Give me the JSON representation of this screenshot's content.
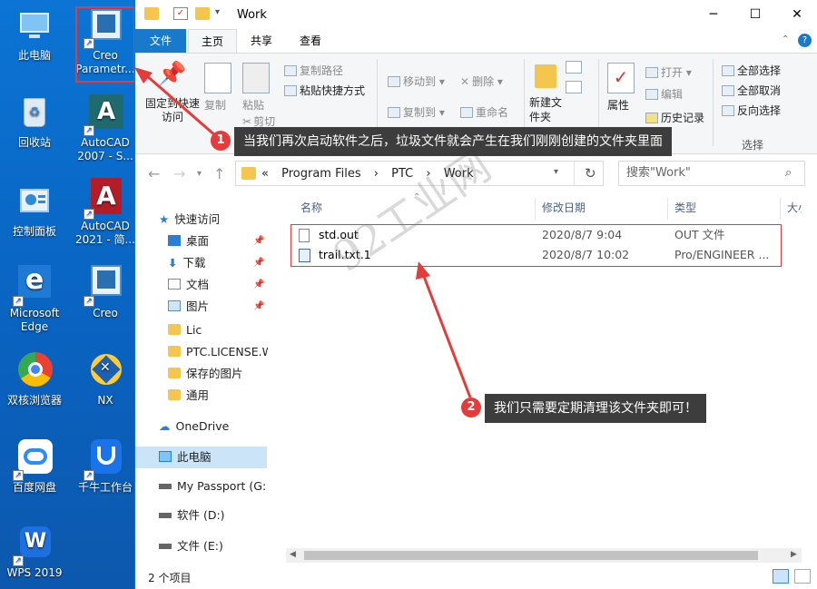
{
  "desktop": {
    "icons": [
      {
        "label": "此电脑",
        "icon": "pc-icon"
      },
      {
        "label": "Creo Parametr...",
        "icon": "creo-icon"
      },
      {
        "label": "回收站",
        "icon": "recycle-bin-icon"
      },
      {
        "label": "AutoCAD 2007 - S...",
        "icon": "autocad-icon"
      },
      {
        "label": "控制面板",
        "icon": "control-panel-icon"
      },
      {
        "label": "AutoCAD 2021 - 简...",
        "icon": "autocad-2021-icon"
      },
      {
        "label": "Microsoft Edge",
        "icon": "edge-icon"
      },
      {
        "label": "Creo",
        "icon": "creo-icon"
      },
      {
        "label": "双核浏览器",
        "icon": "browser-icon"
      },
      {
        "label": "NX",
        "icon": "nx-icon"
      },
      {
        "label": "百度网盘",
        "icon": "baidu-pan-icon"
      },
      {
        "label": "千牛工作台",
        "icon": "qianniu-icon"
      },
      {
        "label": "WPS 2019",
        "icon": "wps-icon"
      }
    ]
  },
  "window": {
    "title": "Work",
    "controls": {
      "minimize": "─",
      "maximize": "☐",
      "close": "✕"
    }
  },
  "ribbon": {
    "tabs": [
      "文件",
      "主页",
      "共享",
      "查看"
    ],
    "groups": {
      "clipboard": {
        "pin": "固定到快速访问",
        "copy": "复制",
        "paste": "粘贴",
        "copy_path": "复制路径",
        "paste_shortcut": "粘贴快捷方式",
        "cut": "剪切"
      },
      "organize": {
        "move_to": "移动到",
        "copy_to": "复制到",
        "delete": "删除",
        "rename": "重命名"
      },
      "new": {
        "new_folder": "新建文件夹"
      },
      "open": {
        "properties": "属性",
        "open": "打开",
        "edit": "编辑",
        "history": "历史记录"
      },
      "select": {
        "select_all": "全部选择",
        "select_none": "全部取消",
        "invert": "反向选择",
        "label": "选择"
      }
    }
  },
  "nav": {
    "back": "←",
    "forward": "→",
    "up": "↑",
    "breadcrumb": [
      "«",
      "Program Files",
      "›",
      "PTC",
      "›",
      "Work"
    ],
    "search_placeholder": "搜索\"Work\""
  },
  "sidebar": {
    "items": [
      {
        "label": "快速访问",
        "icon": "star-icon"
      },
      {
        "label": "桌面",
        "icon": "desktop-icon",
        "pinned": true
      },
      {
        "label": "下载",
        "icon": "download-icon",
        "pinned": true
      },
      {
        "label": "文档",
        "icon": "documents-icon",
        "pinned": true
      },
      {
        "label": "图片",
        "icon": "pictures-icon",
        "pinned": true
      },
      {
        "label": "Lic",
        "icon": "folder-icon"
      },
      {
        "label": "PTC.LICENSE.W",
        "icon": "folder-icon"
      },
      {
        "label": "保存的图片",
        "icon": "folder-icon"
      },
      {
        "label": "通用",
        "icon": "folder-icon"
      },
      {
        "label": "OneDrive",
        "icon": "cloud-icon"
      },
      {
        "label": "此电脑",
        "icon": "pc-icon",
        "selected": true
      },
      {
        "label": "My Passport (G:",
        "icon": "drive-icon"
      },
      {
        "label": "软件 (D:)",
        "icon": "drive-icon"
      },
      {
        "label": "文件 (E:)",
        "icon": "drive-icon"
      }
    ]
  },
  "file_list": {
    "columns": [
      "名称",
      "修改日期",
      "类型",
      "大小"
    ],
    "rows": [
      {
        "name": "std.out",
        "modified": "2020/8/7 9:04",
        "type": "OUT 文件"
      },
      {
        "name": "trail.txt.1",
        "modified": "2020/8/7 10:02",
        "type": "Pro/ENGINEER ..."
      }
    ]
  },
  "status": {
    "item_count": "2 个项目"
  },
  "annotations": [
    {
      "number": "1",
      "text": "当我们再次启动软件之后，垃圾文件就会产生在我们刚刚创建的文件夹里面"
    },
    {
      "number": "2",
      "text": "我们只需要定期清理该文件夹即可！"
    }
  ],
  "watermark": "92工业网",
  "colors": {
    "accent": "#1979ca",
    "annotation_red": "#e53b3b",
    "selection": "#cce4f7"
  }
}
